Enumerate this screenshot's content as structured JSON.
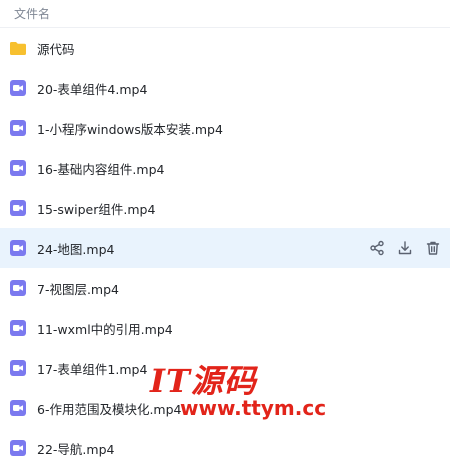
{
  "header": {
    "column_label": "文件名"
  },
  "files": [
    {
      "name": "源代码",
      "icon": "folder-icon",
      "type": "folder"
    },
    {
      "name": "20-表单组件4.mp4",
      "icon": "video-file-icon",
      "type": "video"
    },
    {
      "name": "1-小程序windows版本安装.mp4",
      "icon": "video-file-icon",
      "type": "video"
    },
    {
      "name": "16-基础内容组件.mp4",
      "icon": "video-file-icon",
      "type": "video"
    },
    {
      "name": "15-swiper组件.mp4",
      "icon": "video-file-icon",
      "type": "video"
    },
    {
      "name": "24-地图.mp4",
      "icon": "video-file-icon",
      "type": "video",
      "hovered": true
    },
    {
      "name": "7-视图层.mp4",
      "icon": "video-file-icon",
      "type": "video"
    },
    {
      "name": "11-wxml中的引用.mp4",
      "icon": "video-file-icon",
      "type": "video"
    },
    {
      "name": "17-表单组件1.mp4",
      "icon": "video-file-icon",
      "type": "video"
    },
    {
      "name": "6-作用范围及模块化.mp4",
      "icon": "video-file-icon",
      "type": "video"
    },
    {
      "name": "22-导航.mp4",
      "icon": "video-file-icon",
      "type": "video"
    }
  ],
  "row_actions": [
    "share-icon",
    "download-icon",
    "delete-icon"
  ],
  "watermark": {
    "title": "IT源码",
    "url": "www.ttym.cc"
  },
  "colors": {
    "folder": "#f7c02f",
    "video": "#7b79ef",
    "hover_row": "#e9f3fd",
    "watermark": "#e2241a",
    "action_icon": "#5b6270"
  }
}
